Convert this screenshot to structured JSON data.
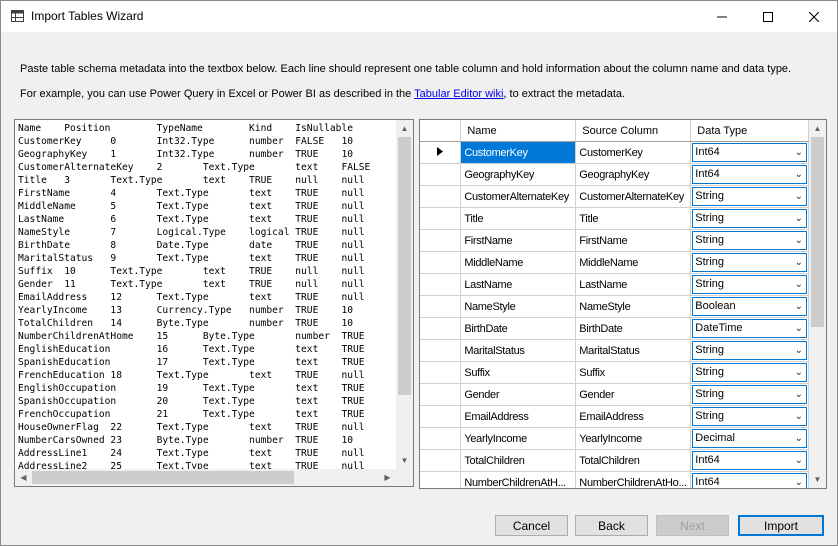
{
  "window": {
    "title": "Import Tables Wizard"
  },
  "instructions": {
    "line1": "Paste table schema metadata into the textbox below. Each line should represent one table column and hold information about the column name and data type.",
    "line2_prefix": "For example, you can use Power Query in Excel or Power BI as described in the ",
    "line2_link": "Tabular Editor wiki",
    "line2_suffix": ", to extract the metadata."
  },
  "metadata_text": "Name    Position        TypeName        Kind    IsNullable\nCustomerKey     0       Int32.Type      number  FALSE   10\nGeographyKey    1       Int32.Type      number  TRUE    10\nCustomerAlternateKey    2       Text.Type       text    FALSE\nTitle   3       Text.Type       text    TRUE    null    null\nFirstName       4       Text.Type       text    TRUE    null\nMiddleName      5       Text.Type       text    TRUE    null\nLastName        6       Text.Type       text    TRUE    null\nNameStyle       7       Logical.Type    logical TRUE    null\nBirthDate       8       Date.Type       date    TRUE    null\nMaritalStatus   9       Text.Type       text    TRUE    null\nSuffix  10      Text.Type       text    TRUE    null    null\nGender  11      Text.Type       text    TRUE    null    null\nEmailAddress    12      Text.Type       text    TRUE    null\nYearlyIncome    13      Currency.Type   number  TRUE    10\nTotalChildren   14      Byte.Type       number  TRUE    10\nNumberChildrenAtHome    15      Byte.Type       number  TRUE\nEnglishEducation        16      Text.Type       text    TRUE\nSpanishEducation        17      Text.Type       text    TRUE\nFrenchEducation 18      Text.Type       text    TRUE    null\nEnglishOccupation       19      Text.Type       text    TRUE\nSpanishOccupation       20      Text.Type       text    TRUE\nFrenchOccupation        21      Text.Type       text    TRUE\nHouseOwnerFlag  22      Text.Type       text    TRUE    null\nNumberCarsOwned 23      Byte.Type       number  TRUE    10\nAddressLine1    24      Text.Type       text    TRUE    null\nAddressLine2    25      Text.Type       text    TRUE    null",
  "grid": {
    "columns": [
      "Name",
      "Source Column",
      "Data Type"
    ],
    "rows": [
      {
        "name": "CustomerKey",
        "source": "CustomerKey",
        "type": "Int64"
      },
      {
        "name": "GeographyKey",
        "source": "GeographyKey",
        "type": "Int64"
      },
      {
        "name": "CustomerAlternateKey",
        "source": "CustomerAlternateKey",
        "type": "String"
      },
      {
        "name": "Title",
        "source": "Title",
        "type": "String"
      },
      {
        "name": "FirstName",
        "source": "FirstName",
        "type": "String"
      },
      {
        "name": "MiddleName",
        "source": "MiddleName",
        "type": "String"
      },
      {
        "name": "LastName",
        "source": "LastName",
        "type": "String"
      },
      {
        "name": "NameStyle",
        "source": "NameStyle",
        "type": "Boolean"
      },
      {
        "name": "BirthDate",
        "source": "BirthDate",
        "type": "DateTime"
      },
      {
        "name": "MaritalStatus",
        "source": "MaritalStatus",
        "type": "String"
      },
      {
        "name": "Suffix",
        "source": "Suffix",
        "type": "String"
      },
      {
        "name": "Gender",
        "source": "Gender",
        "type": "String"
      },
      {
        "name": "EmailAddress",
        "source": "EmailAddress",
        "type": "String"
      },
      {
        "name": "YearlyIncome",
        "source": "YearlyIncome",
        "type": "Decimal"
      },
      {
        "name": "TotalChildren",
        "source": "TotalChildren",
        "type": "Int64"
      },
      {
        "name": "NumberChildrenAtH...",
        "source": "NumberChildrenAtHo...",
        "type": "Int64"
      }
    ]
  },
  "buttons": {
    "cancel": "Cancel",
    "back": "Back",
    "next": "Next",
    "import": "Import"
  },
  "colors": {
    "selection": "#0078d7",
    "link": "#0000ee"
  }
}
